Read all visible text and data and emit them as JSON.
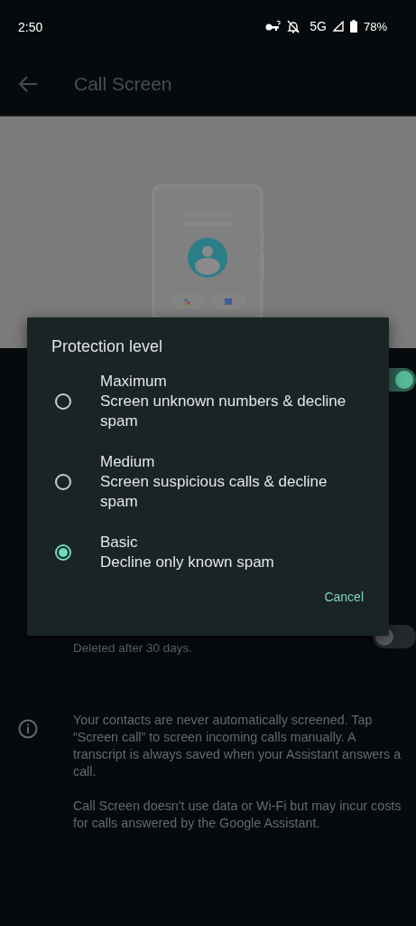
{
  "status_bar": {
    "time": "2:50",
    "network": "5G",
    "battery": "78%"
  },
  "app_bar": {
    "title": "Call Screen"
  },
  "illustration": {
    "kind": "picture"
  },
  "settings": [
    {
      "on": true
    },
    {
      "subtitle": "Deleted after 30 days.",
      "on": false
    }
  ],
  "info": [
    "Your contacts are never automatically screened. Tap “Screen call” to screen incoming calls manually. A transcript is always saved when your Assistant answers a call.",
    "Call Screen doesn't use data or Wi-Fi but may incur costs for calls answered by the Google Assistant."
  ],
  "dialog": {
    "title": "Protection level",
    "options": [
      {
        "label": "Maximum",
        "description": "Screen unknown numbers & decline spam",
        "selected": false
      },
      {
        "label": "Medium",
        "description": "Screen suspicious calls & decline spam",
        "selected": false
      },
      {
        "label": "Basic",
        "description": "Decline only known spam",
        "selected": true
      }
    ],
    "buttons": [
      "Cancel"
    ]
  }
}
